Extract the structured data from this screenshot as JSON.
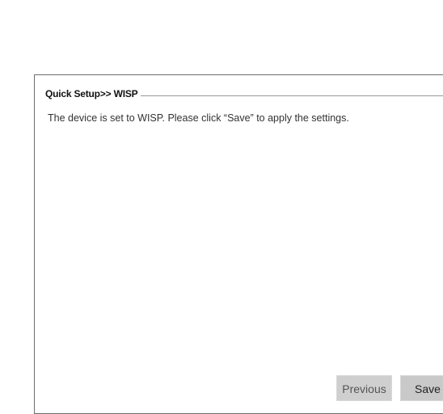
{
  "panel": {
    "title": "Quick Setup>> WISP",
    "message": "The device is set to WISP.  Please click  “Save”  to apply the settings."
  },
  "buttons": {
    "previous_label": "Previous",
    "save_label": "Save"
  }
}
